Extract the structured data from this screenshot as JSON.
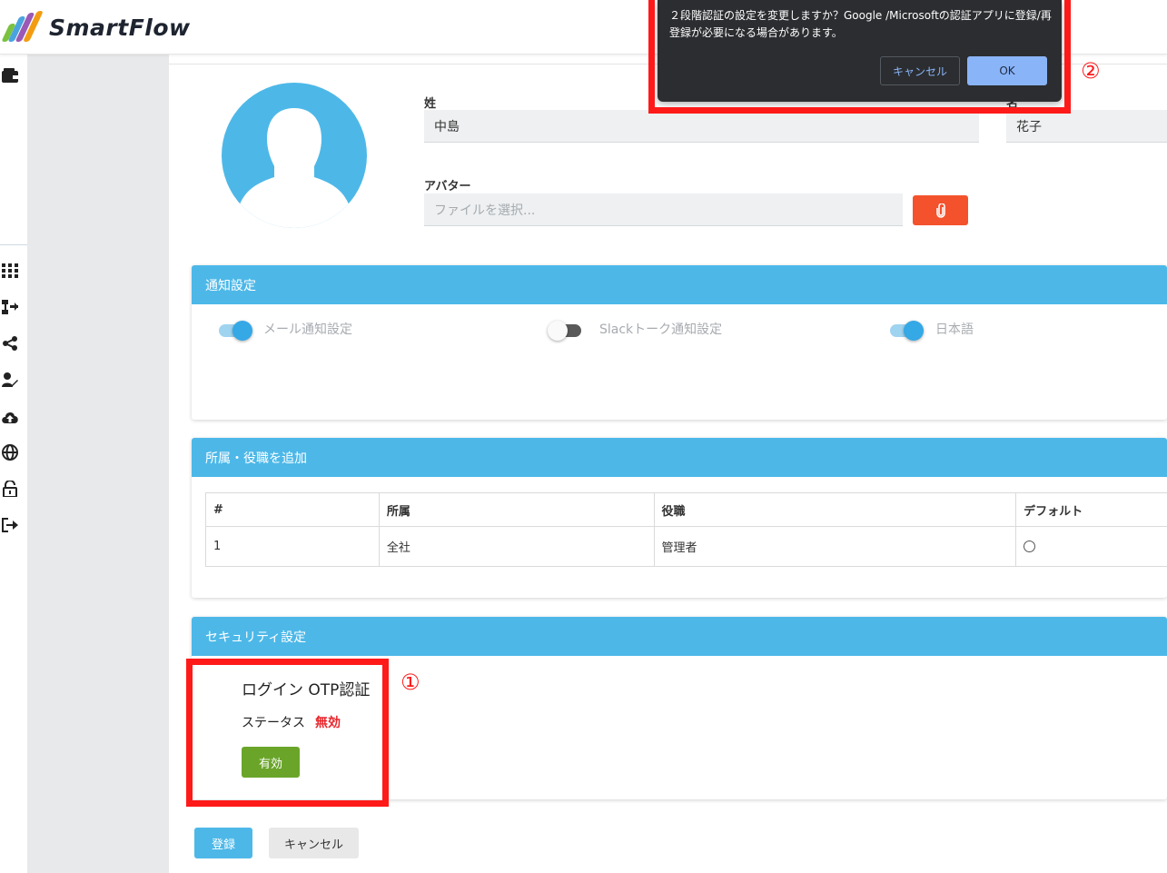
{
  "app": {
    "name": "SmartFlow",
    "colors": {
      "accent": "#4db8e8",
      "danger": "#e8262b",
      "success": "#6aa52a",
      "attach": "#f4522d",
      "annotation": "#ff1a1a"
    }
  },
  "rail_icons": [
    "wallet-icon",
    "grid-icon",
    "flow-icon",
    "share-icon",
    "user-edit-icon",
    "cloud-upload-icon",
    "globe-icon",
    "lock-icon",
    "logout-icon"
  ],
  "profile": {
    "last_name_label": "姓",
    "last_name_value": "中島",
    "first_name_label": "名",
    "first_name_value": "花子",
    "avatar_label": "アバター",
    "avatar_placeholder": "ファイルを選択..."
  },
  "notifications": {
    "title": "通知設定",
    "toggles": [
      {
        "label": "メール通知設定",
        "on": true
      },
      {
        "label": "Slackトーク通知設定",
        "on": false
      },
      {
        "label": "日本語",
        "on": true
      }
    ]
  },
  "affiliation": {
    "title": "所属・役職を追加",
    "columns": [
      "#",
      "所属",
      "役職",
      "デフォルト"
    ],
    "rows": [
      {
        "num": "1",
        "dept": "全社",
        "role": "管理者",
        "default": false
      }
    ]
  },
  "security": {
    "title": "セキュリティ設定",
    "otp_title": "ログイン OTP認証",
    "status_label": "ステータス",
    "status_value": "無効",
    "enable_label": "有効"
  },
  "footer": {
    "submit_label": "登録",
    "cancel_label": "キャンセル"
  },
  "dialog": {
    "message": "２段階認証の設定を変更しますか？Google /Microsoftの認証アプリに登録/再登録が必要になる場合があります。",
    "cancel_label": "キャンセル",
    "ok_label": "OK"
  },
  "annotations": {
    "marker_1": "①",
    "marker_2": "②"
  }
}
